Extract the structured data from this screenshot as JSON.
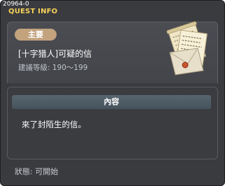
{
  "window": {
    "quest_id": "20964-0",
    "title": "QUEST INFO"
  },
  "quest": {
    "category": "主要",
    "name": "[十字猎人]可疑的信",
    "level": "建議等級: 190～199",
    "icon": "letter-scroll-icon"
  },
  "content": {
    "header": "內容",
    "text": "來了封陌生的信。"
  },
  "status": {
    "text": "狀態:  可開始"
  },
  "colors": {
    "title_yellow": "#f6d25a",
    "badge_tan": "#c2a37e",
    "panel_dark": "#3a3b3f"
  }
}
